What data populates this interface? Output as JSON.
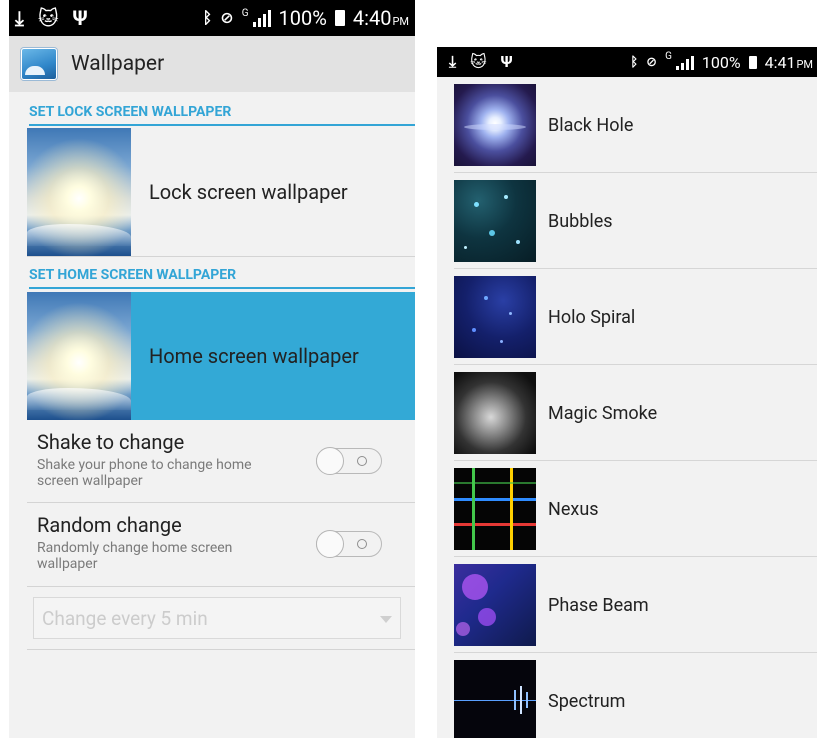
{
  "left_screen": {
    "status_bar": {
      "battery": "100%",
      "time": "4:40",
      "ampm": "PM",
      "signal_label": "G"
    },
    "action_bar": {
      "title": "Wallpaper",
      "icon": "wallpaper-app-icon"
    },
    "lock_section": {
      "header": "SET LOCK SCREEN WALLPAPER",
      "row_label": "Lock screen wallpaper"
    },
    "home_section": {
      "header": "SET HOME SCREEN WALLPAPER",
      "row_label": "Home screen wallpaper",
      "selected": true
    },
    "shake_pref": {
      "title": "Shake to change",
      "summary": "Shake your phone to change home screen wallpaper",
      "enabled": false
    },
    "random_pref": {
      "title": "Random change",
      "summary": "Randomly change home screen wallpaper",
      "enabled": false
    },
    "interval_dropdown": {
      "value": "Change every 5 min",
      "disabled": true
    }
  },
  "right_screen": {
    "status_bar": {
      "battery": "100%",
      "time": "4:41",
      "ampm": "PM",
      "signal_label": "G"
    },
    "live_wallpapers": [
      {
        "name": "Black Hole"
      },
      {
        "name": "Bubbles"
      },
      {
        "name": "Holo Spiral"
      },
      {
        "name": "Magic Smoke"
      },
      {
        "name": "Nexus"
      },
      {
        "name": "Phase Beam"
      },
      {
        "name": "Spectrum"
      }
    ]
  },
  "colors": {
    "accent": "#33a5d6",
    "selected_row": "#33a9d6",
    "background": "#f2f2f2",
    "status_bar": "#000000"
  }
}
